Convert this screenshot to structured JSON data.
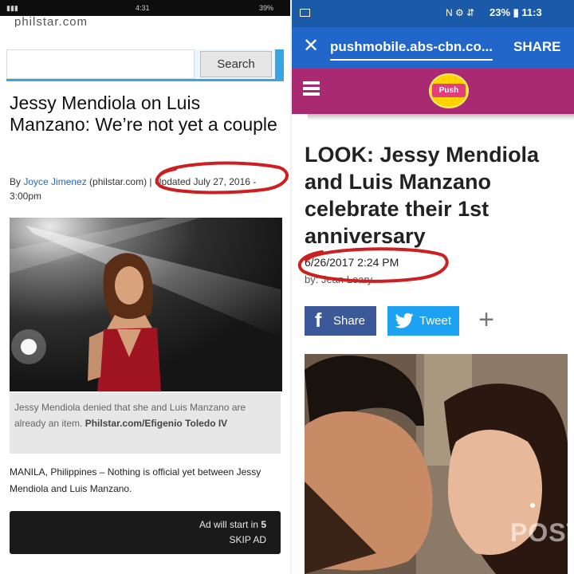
{
  "left_phone": {
    "status_time": "4:31",
    "status_battery": "39%",
    "url_partial": "philstar.com",
    "search_button": "Search",
    "article": {
      "title": "Jessy Mendiola on Luis Manzano: We’re not yet a couple",
      "byline_prefix": "By ",
      "byline_author": "Joyce Jimenez",
      "byline_rest": " (philstar.com) | Updated July 27, 2016 - 3:00pm",
      "caption_text": "Jessy Mendiola denied that she and Luis Manzano are already an item. ",
      "caption_credit": "Philstar.com/Efigenio Toledo IV",
      "body": "MANILA, Philippines – Nothing is official yet between Jessy Mendiola and Luis Manzano."
    },
    "ad": {
      "line1_prefix": "Ad will start in ",
      "countdown": "5",
      "skip": "SKIP AD"
    }
  },
  "right_phone": {
    "status": {
      "icons": "N ⚙ ⇵",
      "battery_time": "23% ▮ 11:3"
    },
    "url_bar": {
      "url": "pushmobile.abs-cbn.co...",
      "share": "SHARE"
    },
    "logo_text": "Push",
    "article": {
      "title": "LOOK: Jessy Mendiola and Luis Manzano celebrate their 1st anniversary",
      "date": "6/26/2017 2:24 PM",
      "author": "by: Jean Leary"
    },
    "share_buttons": {
      "facebook": "Share",
      "twitter": "Tweet",
      "more": "+"
    },
    "photo_watermark": "POST"
  },
  "colors": {
    "push_magenta": "#a92a71",
    "chrome_blue": "#2166c8",
    "annotation_red": "#cc1f1f",
    "facebook_blue": "#3b5998",
    "twitter_blue": "#1da1f2"
  }
}
